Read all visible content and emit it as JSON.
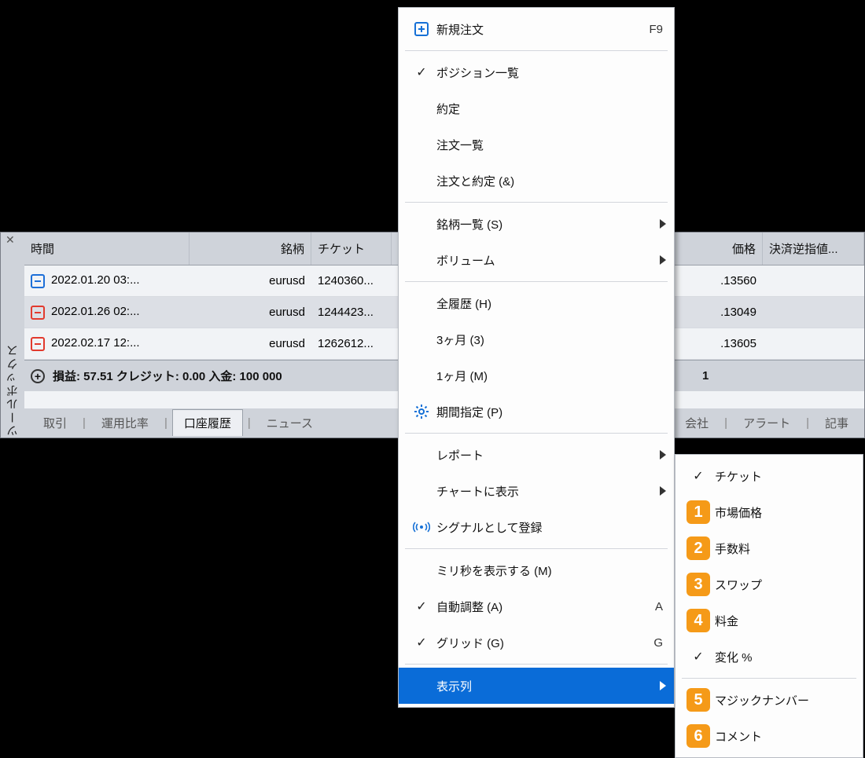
{
  "panel": {
    "title": "ツールボックス",
    "columns": {
      "time": "時間",
      "symbol": "銘柄",
      "ticket": "チケット",
      "price": "価格",
      "sl": "決済逆指値..."
    },
    "rows": [
      {
        "icon": "blue",
        "time": "2022.01.20 03:...",
        "symbol": "eurusd",
        "ticket": "1240360...",
        "price": ".13560"
      },
      {
        "icon": "red",
        "time": "2022.01.26 02:...",
        "symbol": "eurusd",
        "ticket": "1244423...",
        "price": ".13049"
      },
      {
        "icon": "red",
        "time": "2022.02.17 12:...",
        "symbol": "eurusd",
        "ticket": "1262612...",
        "price": ".13605"
      }
    ],
    "summary": {
      "left": "損益: 57.51  クレジット: 0.00  入金: 100 000",
      "right": "1"
    },
    "tabs": [
      "取引",
      "運用比率",
      "口座履歴",
      "ニュース"
    ],
    "active_tab": "口座履歴",
    "tabs_right": [
      "会社",
      "アラート",
      "記事"
    ]
  },
  "menu": {
    "new_order": {
      "label": "新規注文",
      "accel": "F9"
    },
    "positions": "ポジション一覧",
    "fills": "約定",
    "orders": "注文一覧",
    "orders_fills": "注文と約定 (&)",
    "symbols": "銘柄一覧 (S)",
    "volume": "ボリューム",
    "all_history": "全履歴 (H)",
    "three_months": "3ヶ月 (3)",
    "one_month": "1ヶ月 (M)",
    "period": "期間指定 (P)",
    "report": "レポート",
    "show_on_chart": "チャートに表示",
    "register_signal": "シグナルとして登録",
    "show_ms": "ミリ秒を表示する (M)",
    "autosize": {
      "label": "自動調整 (A)",
      "accel": "A"
    },
    "grid": {
      "label": "グリッド (G)",
      "accel": "G"
    },
    "columns": "表示列"
  },
  "submenu": {
    "items": [
      {
        "check": true,
        "label": "チケット"
      },
      {
        "badge": "1",
        "label": "市場価格"
      },
      {
        "badge": "2",
        "label": "手数料"
      },
      {
        "badge": "3",
        "label": "スワップ"
      },
      {
        "badge": "4",
        "label": "料金"
      },
      {
        "check": true,
        "label": "変化 %",
        "sep_after": false
      },
      {
        "badge": "5",
        "label": "マジックナンバー"
      },
      {
        "badge": "6",
        "label": "コメント"
      }
    ]
  }
}
